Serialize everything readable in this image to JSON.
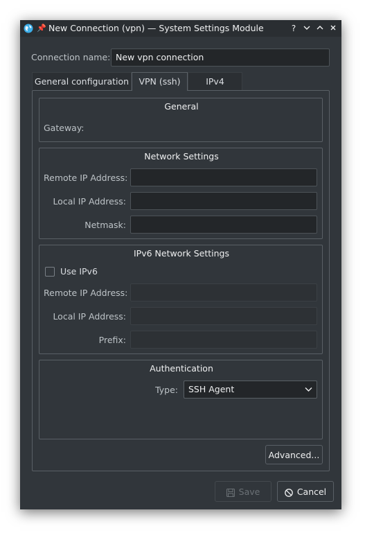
{
  "window": {
    "title": "New Connection (vpn) — System Settings Module",
    "controls": {
      "help": "?",
      "minimize": "⌄",
      "maximize": "⌃",
      "close": "×"
    }
  },
  "connection": {
    "name_label": "Connection name:",
    "name_value": "New vpn connection"
  },
  "tabs": [
    {
      "label": "General configuration",
      "active": false
    },
    {
      "label": "VPN (ssh)",
      "active": true
    },
    {
      "label": "IPv4",
      "active": false
    }
  ],
  "general": {
    "title": "General",
    "gateway_label": "Gateway:"
  },
  "network": {
    "title": "Network Settings",
    "remote_ip_label": "Remote IP Address:",
    "remote_ip_value": "",
    "local_ip_label": "Local IP Address:",
    "local_ip_value": "",
    "netmask_label": "Netmask:",
    "netmask_value": ""
  },
  "ipv6": {
    "title": "IPv6 Network Settings",
    "use_ipv6_label": "Use IPv6",
    "use_ipv6_checked": false,
    "remote_ip_label": "Remote IP Address:",
    "local_ip_label": "Local IP Address:",
    "prefix_label": "Prefix:"
  },
  "auth": {
    "title": "Authentication",
    "type_label": "Type:",
    "type_value": "SSH Agent"
  },
  "buttons": {
    "advanced": "Advanced...",
    "save": "Save",
    "cancel": "Cancel"
  },
  "colors": {
    "window_bg": "#31363b",
    "field_bg": "#232629",
    "border": "#5a6066",
    "text": "#eff0f1",
    "accent": "#3daee9"
  }
}
